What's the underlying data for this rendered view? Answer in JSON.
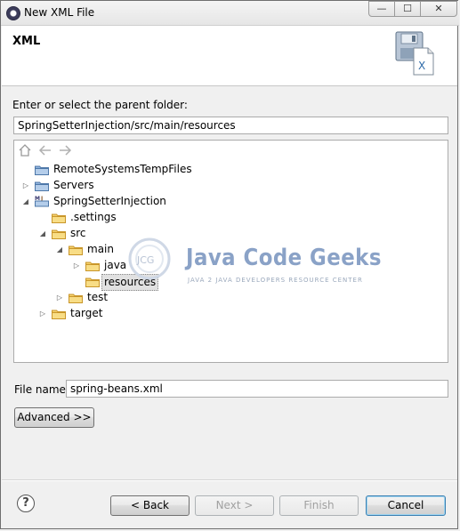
{
  "window": {
    "title": "New XML File"
  },
  "banner": {
    "title": "XML",
    "icon": "xml-file-save-icon"
  },
  "parent_folder": {
    "label": "Enter or select the parent folder:",
    "value": "SpringSetterInjection/src/main/resources"
  },
  "tree": {
    "toolbar_icons": [
      "home-icon",
      "back-arrow-icon",
      "forward-arrow-icon"
    ],
    "items": [
      {
        "label": "RemoteSystemsTempFiles",
        "depth": 0,
        "expanded": null,
        "icon": "project-folder-icon"
      },
      {
        "label": "Servers",
        "depth": 0,
        "expanded": false,
        "icon": "project-folder-icon"
      },
      {
        "label": "SpringSetterInjection",
        "depth": 0,
        "expanded": true,
        "icon": "maven-java-project-icon"
      },
      {
        "label": ".settings",
        "depth": 1,
        "expanded": null,
        "icon": "folder-icon"
      },
      {
        "label": "src",
        "depth": 1,
        "expanded": true,
        "icon": "folder-icon"
      },
      {
        "label": "main",
        "depth": 2,
        "expanded": true,
        "icon": "folder-icon"
      },
      {
        "label": "java",
        "depth": 3,
        "expanded": false,
        "icon": "folder-icon"
      },
      {
        "label": "resources",
        "depth": 3,
        "expanded": null,
        "icon": "folder-icon",
        "selected": true
      },
      {
        "label": "test",
        "depth": 2,
        "expanded": false,
        "icon": "folder-icon"
      },
      {
        "label": "target",
        "depth": 1,
        "expanded": false,
        "icon": "folder-icon"
      }
    ]
  },
  "watermark": {
    "logo_text": "JCG",
    "title": "Java Code Geeks",
    "subtitle": "JAVA 2 JAVA DEVELOPERS RESOURCE CENTER"
  },
  "file_name": {
    "label": "File name:",
    "value": "spring-beans.xml"
  },
  "buttons": {
    "advanced": "Advanced >>",
    "back": "< Back",
    "next": "Next >",
    "finish": "Finish",
    "cancel": "Cancel",
    "help": "?"
  },
  "window_controls": {
    "minimize": "—",
    "maximize": "☐",
    "close": "✕"
  }
}
